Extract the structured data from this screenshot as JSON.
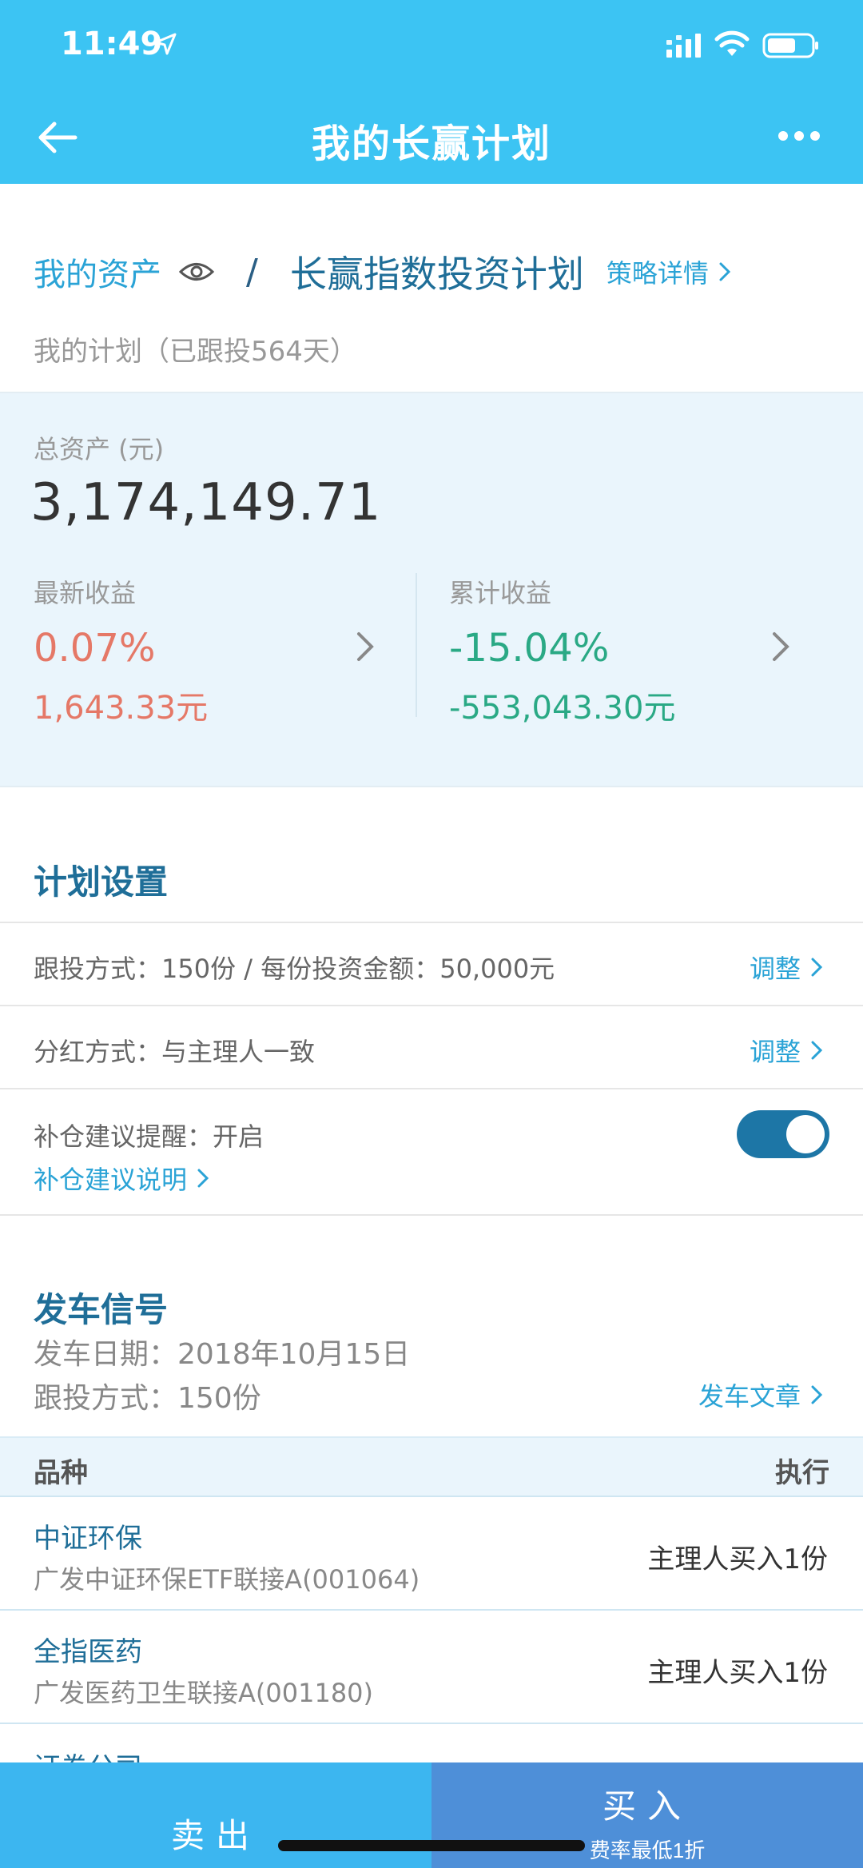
{
  "status_bar": {
    "time": "11:49"
  },
  "nav": {
    "title": "我的长赢计划"
  },
  "breadcrumb": {
    "assets_label": "我的资产",
    "separator": "/",
    "plan_name": "长赢指数投资计划",
    "strategy_link": "策略详情"
  },
  "plan_subtitle": "我的计划（已跟投564天）",
  "assets": {
    "total_label": "总资产 (元)",
    "total_value": "3,174,149.71",
    "latest": {
      "label": "最新收益",
      "percent": "0.07%",
      "amount": "1,643.33元"
    },
    "cumulative": {
      "label": "累计收益",
      "percent": "-15.04%",
      "amount": "-553,043.30元"
    }
  },
  "plan_settings": {
    "title": "计划设置",
    "rows": [
      {
        "text": "跟投方式：150份 / 每份投资金额：50,000元",
        "link": "调整"
      },
      {
        "text": "分红方式：与主理人一致",
        "link": "调整"
      }
    ],
    "reminder_text": "补仓建议提醒：开启",
    "reminder_on": true,
    "reminder_explain": "补仓建议说明"
  },
  "signal": {
    "title": "发车信号",
    "date_line": "发车日期：2018年10月15日",
    "mode_line": "跟投方式：150份",
    "article_link": "发车文章",
    "table_head": {
      "left": "品种",
      "right": "执行"
    },
    "rows": [
      {
        "name": "中证环保",
        "code": "广发中证环保ETF联接A(001064)",
        "action": "主理人买入1份"
      },
      {
        "name": "全指医药",
        "code": "广发医药卫生联接A(001180)",
        "action": "主理人买入1份"
      }
    ],
    "partial_row_name": "证券公司"
  },
  "bottom": {
    "sell": "卖出",
    "buy": "买入",
    "buy_sub": "费率最低1折"
  },
  "colors": {
    "header": "#3cc4f3",
    "positive": "#e57867",
    "negative": "#2aa985",
    "link": "#2aa3d6",
    "sell_button": "#3cb6f0",
    "buy_button": "#4e8fd8"
  }
}
